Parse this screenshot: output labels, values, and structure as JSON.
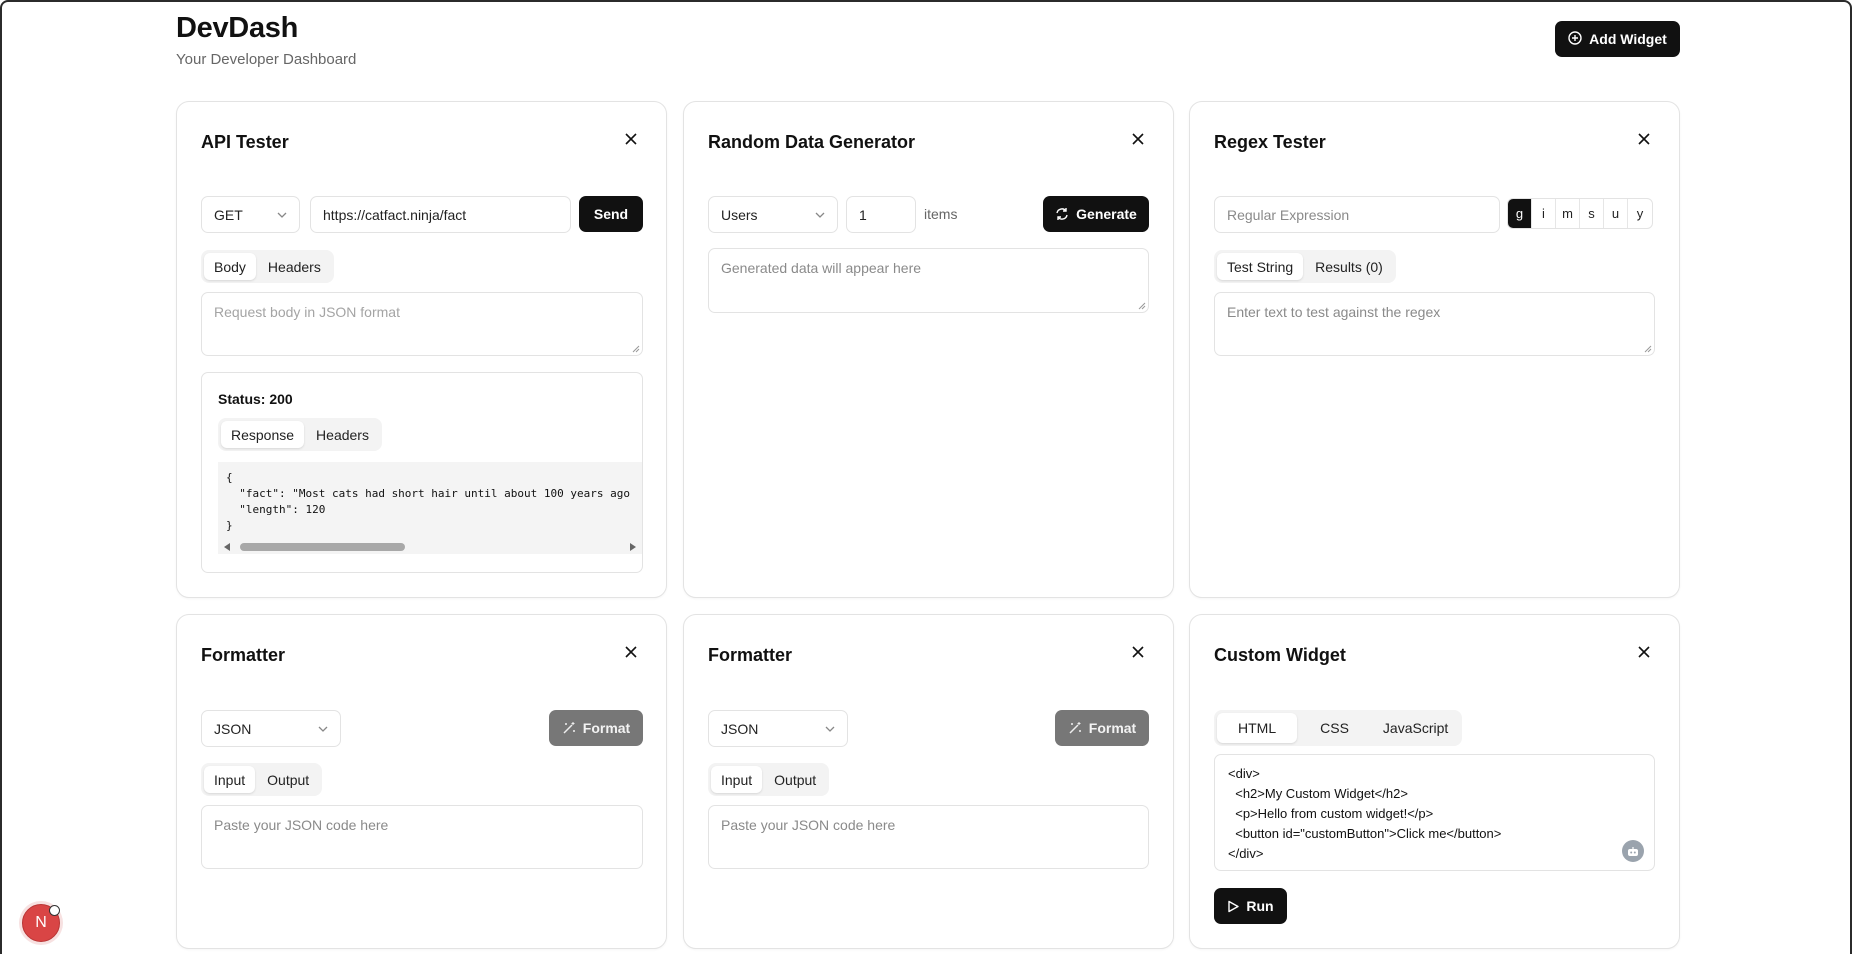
{
  "header": {
    "title": "DevDash",
    "subtitle": "Your Developer Dashboard",
    "add_widget_label": "Add Widget"
  },
  "api_tester": {
    "title": "API Tester",
    "method": "GET",
    "url": "https://catfact.ninja/fact",
    "send_label": "Send",
    "request_tabs": [
      "Body",
      "Headers"
    ],
    "body_placeholder": "Request body in JSON format",
    "status": "Status: 200",
    "response_tabs": [
      "Response",
      "Headers"
    ],
    "response_lines": [
      "{",
      "  \"fact\": \"Most cats had short hair until about 100 years ago",
      "  \"length\": 120",
      "}"
    ]
  },
  "random_data": {
    "title": "Random Data Generator",
    "type": "Users",
    "count": "1",
    "items_label": "items",
    "generate_label": "Generate",
    "output_placeholder": "Generated data will appear here"
  },
  "regex_tester": {
    "title": "Regex Tester",
    "regex_placeholder": "Regular Expression",
    "flags": [
      "g",
      "i",
      "m",
      "s",
      "u",
      "y"
    ],
    "tabs": [
      "Test String",
      "Results (0)"
    ],
    "test_placeholder": "Enter text to test against the regex"
  },
  "formatter_1": {
    "title": "Formatter",
    "language": "JSON",
    "format_label": "Format",
    "tabs": [
      "Input",
      "Output"
    ],
    "input_placeholder": "Paste your JSON code here"
  },
  "formatter_2": {
    "title": "Formatter",
    "language": "JSON",
    "format_label": "Format",
    "tabs": [
      "Input",
      "Output"
    ],
    "input_placeholder": "Paste your JSON code here"
  },
  "custom_widget": {
    "title": "Custom Widget",
    "tabs": [
      "HTML",
      "CSS",
      "JavaScript"
    ],
    "code_lines": [
      "<div>",
      "  <h2>My Custom Widget</h2>",
      "  <p>Hello from custom widget!</p>",
      "  <button id=\"customButton\">Click me</button>",
      "</div>"
    ],
    "run_label": "Run"
  },
  "user": {
    "avatar_initial": "N"
  },
  "colors": {
    "primary": "#111111",
    "disabled": "#777777",
    "border": "#e3e3e3",
    "avatar": "#d94545"
  }
}
